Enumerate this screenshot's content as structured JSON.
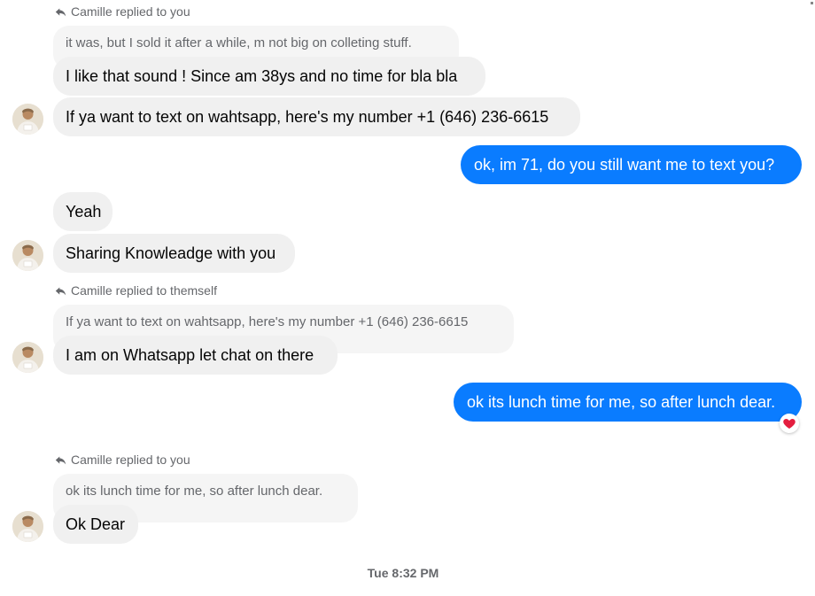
{
  "conversation": {
    "reply_hint_1": "Camille replied to you",
    "quoted_1": "it was, but I sold it after a while, m not big on colleting stuff.",
    "msg_1": "I like that sound ! Since am 38ys and no time for bla bla",
    "msg_2": "If ya want to text on wahtsapp, here's my number +1 (646) 236-6615",
    "out_1": "ok, im 71, do you still want me to text you?",
    "msg_3": "Yeah",
    "msg_4": "Sharing Knowleadge with you",
    "reply_hint_2": "Camille replied to themself",
    "quoted_2": "If ya want to text on wahtsapp, here's my number +1 (646) 236-6615",
    "msg_5": "I am on Whatsapp let chat on there",
    "out_2": "ok its lunch time for me, so after lunch dear.",
    "out_2_reaction": "heart",
    "reply_hint_3": "Camille replied to you",
    "quoted_3": "ok its lunch time for me, so after lunch dear.",
    "msg_6": "Ok Dear",
    "timestamp": "Tue 8:32 PM"
  },
  "colors": {
    "outgoing_bubble": "#0a7cff",
    "incoming_bubble": "#f0f0f0",
    "quoted_bubble": "#f5f5f5",
    "secondary_text": "#65676b",
    "reaction": "#e41e3f"
  },
  "icons": {
    "reply": "reply-arrow-icon",
    "reaction": "heart-icon",
    "avatar": "contact-avatar"
  }
}
